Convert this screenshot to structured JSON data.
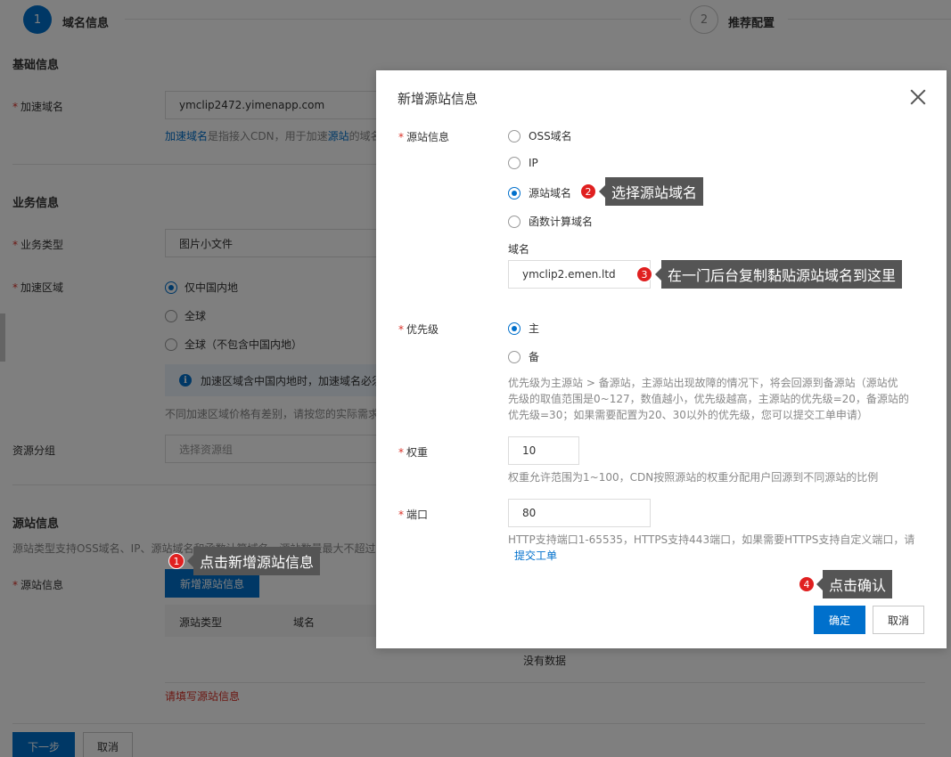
{
  "steps": [
    {
      "number": "1",
      "label": "域名信息"
    },
    {
      "number": "2",
      "label": "推荐配置"
    }
  ],
  "basic": {
    "section_title": "基础信息",
    "domain_label": "加速域名",
    "domain_value": "ymclip2472.yimenapp.com",
    "domain_hint_link1": "加速域名",
    "domain_hint_text1": "是指接入CDN，用于加速",
    "domain_hint_link2": "源站",
    "domain_hint_text2": "的域名"
  },
  "business": {
    "section_title": "业务信息",
    "type_label": "业务类型",
    "type_value": "图片小文件",
    "region_label": "加速区域",
    "region_options": [
      "仅中国内地",
      "全球",
      "全球（不包含中国内地）"
    ],
    "region_selected": "仅中国内地",
    "info_text": "加速区域含中国内地时，加速域名必须",
    "price_hint": "不同加速区域价格有差别，请按您的实际需求"
  },
  "resource": {
    "label": "资源分组",
    "placeholder": "选择资源组"
  },
  "origin_section": {
    "section_title": "源站信息",
    "desc": "源站类型支持OSS域名、IP、源站域名和函数计算域名，源站数量最大不超过",
    "label": "源站信息",
    "add_button": "新增源站信息",
    "table_headers": [
      "源站类型",
      "域名"
    ],
    "empty_text": "没有数据",
    "error_text": "请填写源站信息"
  },
  "footer": {
    "next_button": "下一步",
    "cancel_button": "取消"
  },
  "modal": {
    "title": "新增源站信息",
    "origin_label": "源站信息",
    "origin_options": [
      "OSS域名",
      "IP",
      "源站域名",
      "函数计算域名"
    ],
    "origin_selected": "源站域名",
    "domain_sublabel": "域名",
    "domain_value": "ymclip2.emen.ltd",
    "priority_label": "优先级",
    "priority_options": [
      "主",
      "备"
    ],
    "priority_selected": "主",
    "priority_hint_line1": "优先级为主源站 > 备源站，主源站出现故障的情况下，将会回源到备源站（源站优",
    "priority_hint_line2": "先级的取值范围是0~127，数值越小，优先级越高，主源站的优先级=20，备源站的",
    "priority_hint_line3": "优先级=30；如果需要配置为20、30以外的优先级，您可以提交工单申请）",
    "weight_label": "权重",
    "weight_value": "10",
    "weight_hint": "权重允许范围为1~100，CDN按照源站的权重分配用户回源到不同源站的比例",
    "port_label": "端口",
    "port_value": "80",
    "port_hint_line1": "HTTP支持端口1-65535，HTTPS支持443端口，如果需要HTTPS支持自定义端口，请",
    "port_hint_link": "提交工单",
    "confirm_button": "确定",
    "cancel_button": "取消"
  },
  "annotations": [
    {
      "number": "1",
      "text": "点击新增源站信息"
    },
    {
      "number": "2",
      "text": "选择源站域名"
    },
    {
      "number": "3",
      "text": "在一门后台复制黏贴源站域名到这里"
    },
    {
      "number": "4",
      "text": "点击确认"
    }
  ],
  "colors": {
    "primary": "#0070cc",
    "required": "#d93026",
    "badge": "#e02020",
    "callout": "#555555"
  }
}
